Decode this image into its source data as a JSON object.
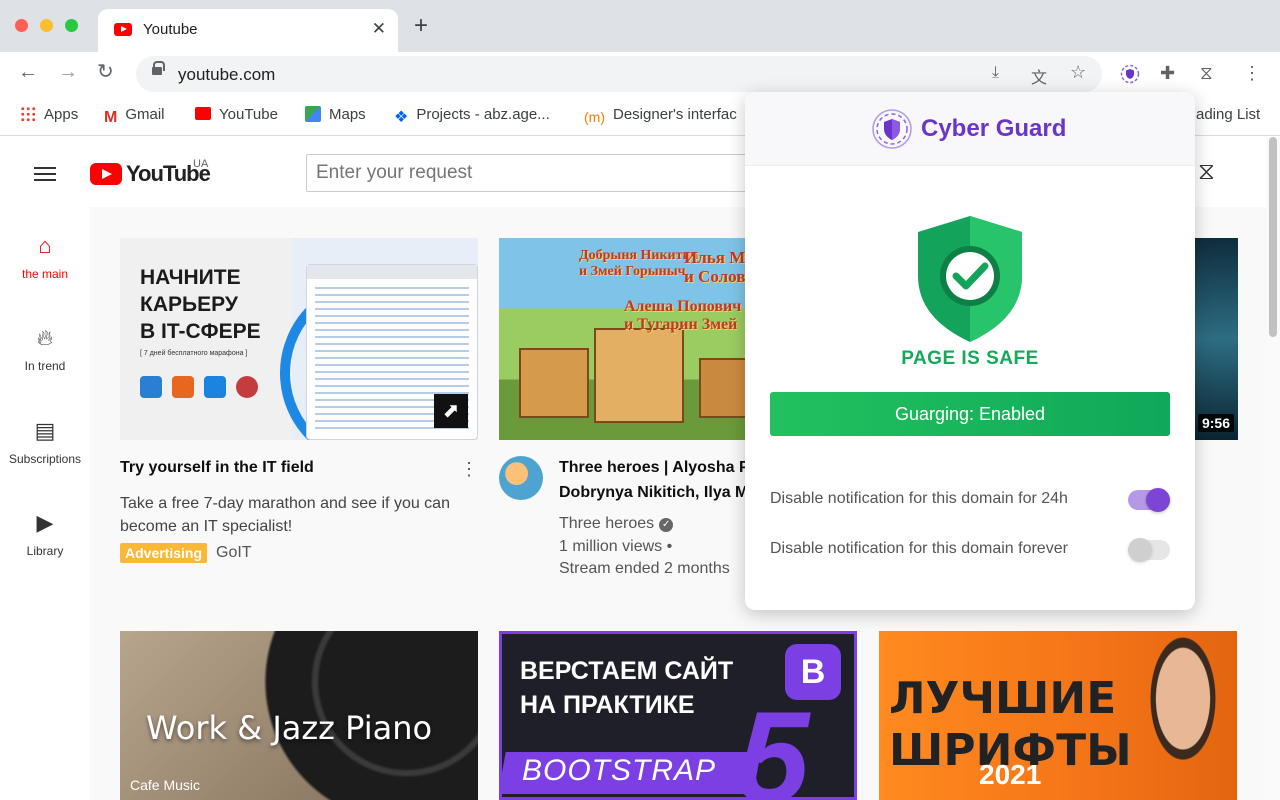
{
  "browser": {
    "tab": {
      "title": "Youtube"
    },
    "new_tab_symbol": "+",
    "tab_close_symbol": "✕",
    "url": "youtube.com",
    "bookmarks": [
      {
        "label": "Apps",
        "icon": "apps-grid-icon",
        "color": "#ea4335"
      },
      {
        "label": "Gmail",
        "icon": "gmail-icon",
        "color": "#d93025"
      },
      {
        "label": "YouTube",
        "icon": "youtube-icon",
        "color": "#ff0000"
      },
      {
        "label": "Maps",
        "icon": "maps-icon",
        "color": "#34a853"
      },
      {
        "label": "Projects - abz.age...",
        "icon": "dropbox-icon",
        "color": "#0061fe"
      },
      {
        "label": "Designer's interfac",
        "icon": "designer-icon",
        "color": "#f57c00"
      },
      {
        "label": "ading List",
        "icon": "reading-list-icon",
        "color": "#5f6368"
      }
    ]
  },
  "youtube": {
    "logo_text": "YouTube",
    "region": "UA",
    "search_placeholder": "Enter your request",
    "sidebar": [
      {
        "label": "the main",
        "icon": "home-icon",
        "active": true
      },
      {
        "label": "In trend",
        "icon": "fire-icon",
        "active": false
      },
      {
        "label": "Subscriptions",
        "icon": "subscriptions-icon",
        "active": false
      },
      {
        "label": "Library",
        "icon": "library-icon",
        "active": false
      }
    ],
    "videos": [
      {
        "thumb_title": "НАЧНИТЕ\nКАРЬЕРУ\nВ IT-СФЕРЕ",
        "thumb_sub": "[ 7 дней бесплатного марафона ]",
        "title": "Try yourself in the IT field",
        "desc": "Take a free 7-day marathon and see if you can become an IT specialist!",
        "badge": "Advertising",
        "channel": "GoIT"
      },
      {
        "thumb_text_1": "Добрыня Никитич\nи Змей Горыныч",
        "thumb_text_2": "Илья М\nи Соловей",
        "thumb_text_3": "Алеша Попович\nи Тугарин Змей",
        "title": "Three heroes | Alyosha P",
        "title_line2": "Dobrynya Nikitich, Ilya M",
        "channel": "Three heroes",
        "views": "1 million views •",
        "status": "Stream ended 2 months"
      },
      {
        "duration": "9:56"
      }
    ],
    "bottom_row": [
      {
        "title": "Work & Jazz Piano",
        "sub": "Cafe Music"
      },
      {
        "title": "ВЕРСТАЕМ САЙТ\nНА ПРАКТИКЕ",
        "badge": "B",
        "big": "5",
        "strip": "BOOTSTRAP"
      },
      {
        "title": "ЛУЧШИЕ\nШРИФТЫ",
        "year": "2021"
      }
    ]
  },
  "extension": {
    "name": "Cyber Guard",
    "status_text": "PAGE IS SAFE",
    "guard_button": "Guarging: Enabled",
    "options": [
      {
        "label": "Disable notification for this domain for 24h",
        "enabled": true
      },
      {
        "label": "Disable notification for this domain forever",
        "enabled": false
      }
    ],
    "colors": {
      "brand": "#6a35c8",
      "safe": "#17a85a",
      "button": "#1eb85c",
      "toggle_on": "#7d45d6"
    }
  }
}
